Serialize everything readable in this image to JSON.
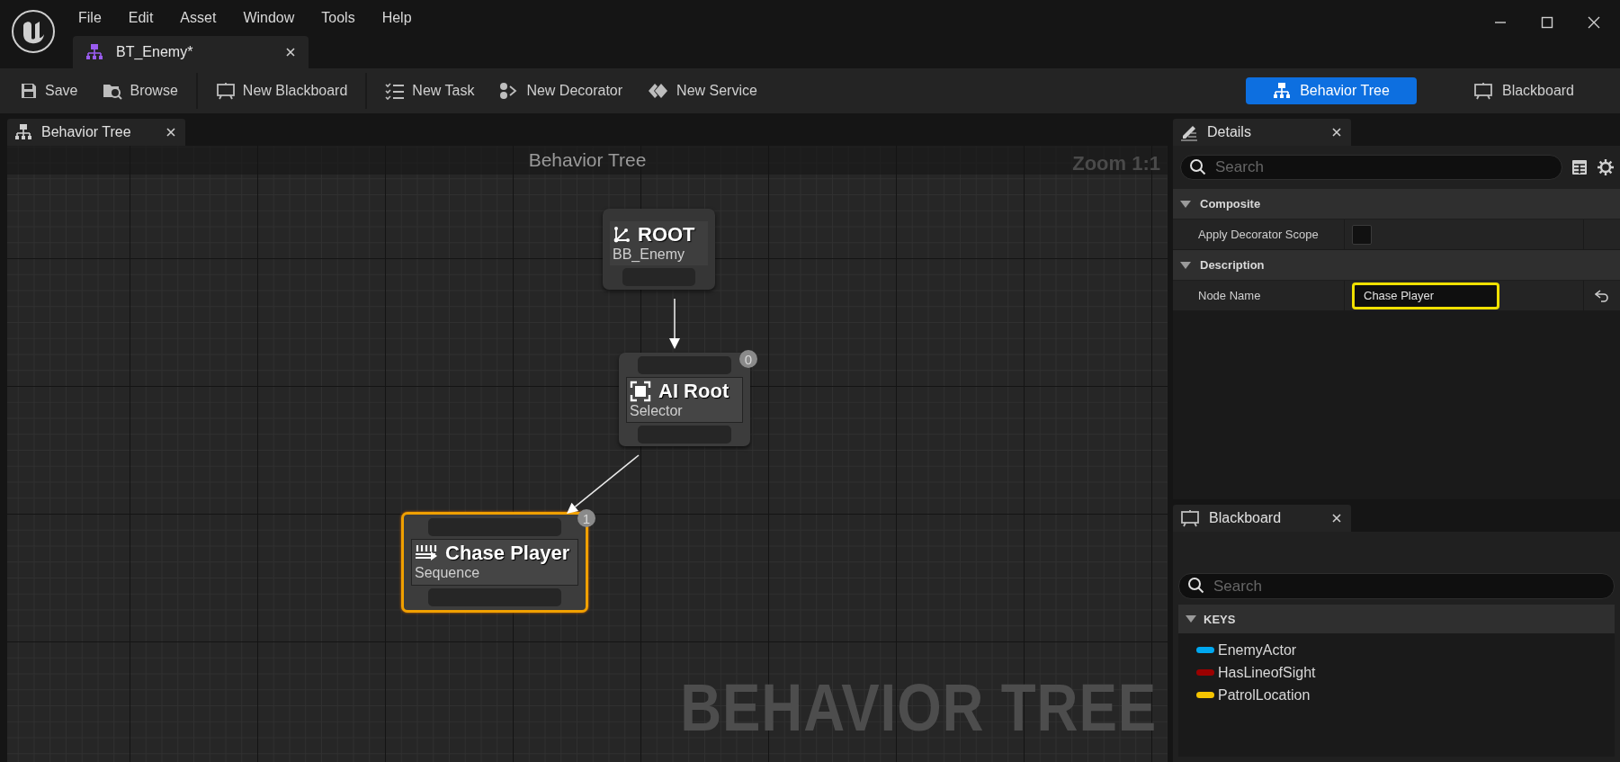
{
  "menu": [
    "File",
    "Edit",
    "Asset",
    "Window",
    "Tools",
    "Help"
  ],
  "document_tab": {
    "title": "BT_Enemy*"
  },
  "toolbar": [
    {
      "label": "Save"
    },
    {
      "label": "Browse"
    },
    {
      "label": "New Blackboard"
    },
    {
      "label": "New Task"
    },
    {
      "label": "New Decorator"
    },
    {
      "label": "New Service"
    }
  ],
  "modes": [
    {
      "label": "Behavior Tree",
      "selected": true
    },
    {
      "label": "Blackboard",
      "selected": false
    }
  ],
  "graph": {
    "tab": "Behavior Tree",
    "header": "Behavior Tree",
    "zoom": "Zoom 1:1",
    "watermark": "BEHAVIOR TREE",
    "root": {
      "title": "ROOT",
      "subtitle": "BB_Enemy",
      "kind": "root",
      "selected": false,
      "children": [
        {
          "title": "AI Root",
          "subtitle": "Selector",
          "kind": "selector",
          "badge": "0",
          "selected": false,
          "children": [
            {
              "title": "Chase Player",
              "subtitle": "Sequence",
              "kind": "sequence",
              "badge": "1",
              "selected": true
            }
          ]
        }
      ]
    }
  },
  "details": {
    "tab": "Details",
    "search": {
      "placeholder": "Search"
    },
    "sections": [
      {
        "title": "Composite",
        "expanded": true,
        "rows": [
          {
            "label": "Apply Decorator Scope",
            "kind": "checkbox",
            "checked": false
          }
        ]
      },
      {
        "title": "Description",
        "expanded": true,
        "rows": [
          {
            "label": "Node Name",
            "kind": "text",
            "value": "Chase Player",
            "focused": true,
            "modified": true
          }
        ]
      }
    ]
  },
  "blackboard": {
    "tab": "Blackboard",
    "search": {
      "placeholder": "Search"
    },
    "keys_header": "KEYS",
    "keys_expanded": true,
    "keys": [
      {
        "name": "EnemyActor",
        "color": "#00a8f0"
      },
      {
        "name": "HasLineofSight",
        "color": "#9b0000"
      },
      {
        "name": "PatrolLocation",
        "color": "#f5c400"
      }
    ]
  }
}
